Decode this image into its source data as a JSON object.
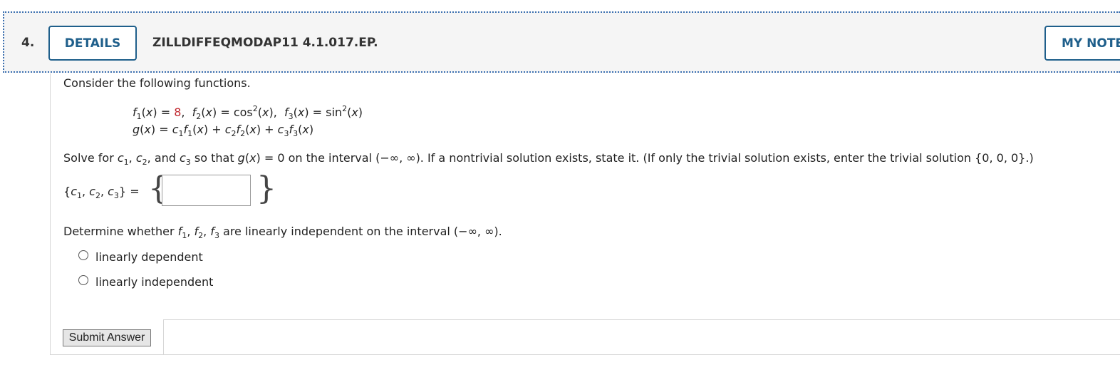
{
  "header": {
    "question_number": "4.",
    "details_label": "DETAILS",
    "question_id": "ZILLDIFFEQMODAP11 4.1.017.EP.",
    "my_notes_label": "MY NOTES"
  },
  "body": {
    "intro": "Consider the following functions.",
    "f1_value": "8",
    "solve_prompt_a": "Solve for ",
    "solve_prompt_b": ", and ",
    "solve_prompt_c": " so that ",
    "solve_prompt_d": " = 0 on the interval (−∞, ∞). If a nontrivial solution exists, state it. (If only the trivial solution exists, enter the trivial solution {0, 0, 0}.)",
    "answer_label_equals": "=",
    "answer_value": "",
    "determine_prompt_a": "Determine whether ",
    "determine_prompt_b": " are linearly independent on the interval (−∞, ∞).",
    "options": [
      "linearly dependent",
      "linearly independent"
    ],
    "submit_label": "Submit Answer"
  },
  "colors": {
    "accent": "#1f5f8b",
    "highlight": "#c1272d",
    "header_bg": "#f5f5f5",
    "header_border": "#3b6fb0"
  }
}
